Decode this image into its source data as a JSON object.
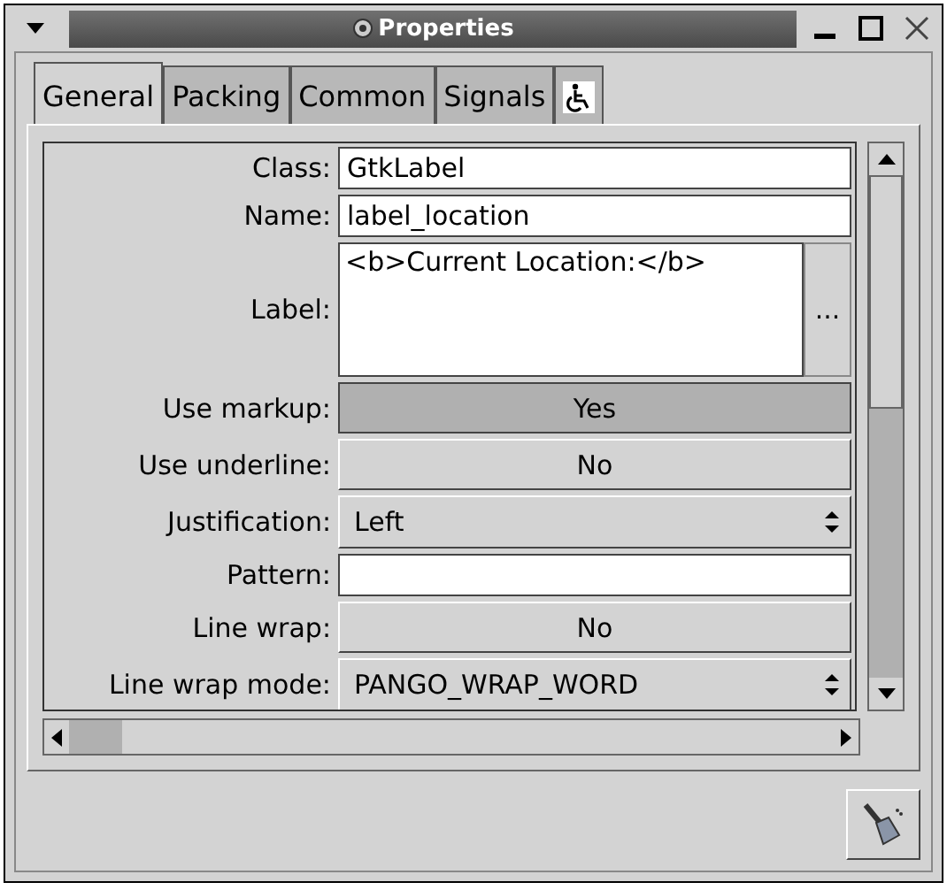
{
  "window": {
    "title": "Properties"
  },
  "tabs": [
    {
      "label": "General",
      "selected": true
    },
    {
      "label": "Packing",
      "selected": false
    },
    {
      "label": "Common",
      "selected": false
    },
    {
      "label": "Signals",
      "selected": false
    },
    {
      "kind": "icon",
      "selected": false
    }
  ],
  "properties": [
    {
      "label": "Class:",
      "kind": "entry",
      "value": "GtkLabel"
    },
    {
      "label": "Name:",
      "kind": "entry",
      "value": "label_location"
    },
    {
      "label": "Label:",
      "kind": "text",
      "value": "<b>Current Location:</b>",
      "button": "..."
    },
    {
      "label": "Use markup:",
      "kind": "toggle",
      "value": "Yes",
      "pressed": true
    },
    {
      "label": "Use underline:",
      "kind": "toggle",
      "value": "No",
      "pressed": false
    },
    {
      "label": "Justification:",
      "kind": "combo",
      "value": "Left"
    },
    {
      "label": "Pattern:",
      "kind": "entry"
    },
    {
      "label": "Line wrap:",
      "kind": "toggle",
      "value": "No",
      "pressed": false
    },
    {
      "label": "Line wrap mode:",
      "kind": "combo",
      "value": "PANGO_WRAP_WORD"
    }
  ]
}
